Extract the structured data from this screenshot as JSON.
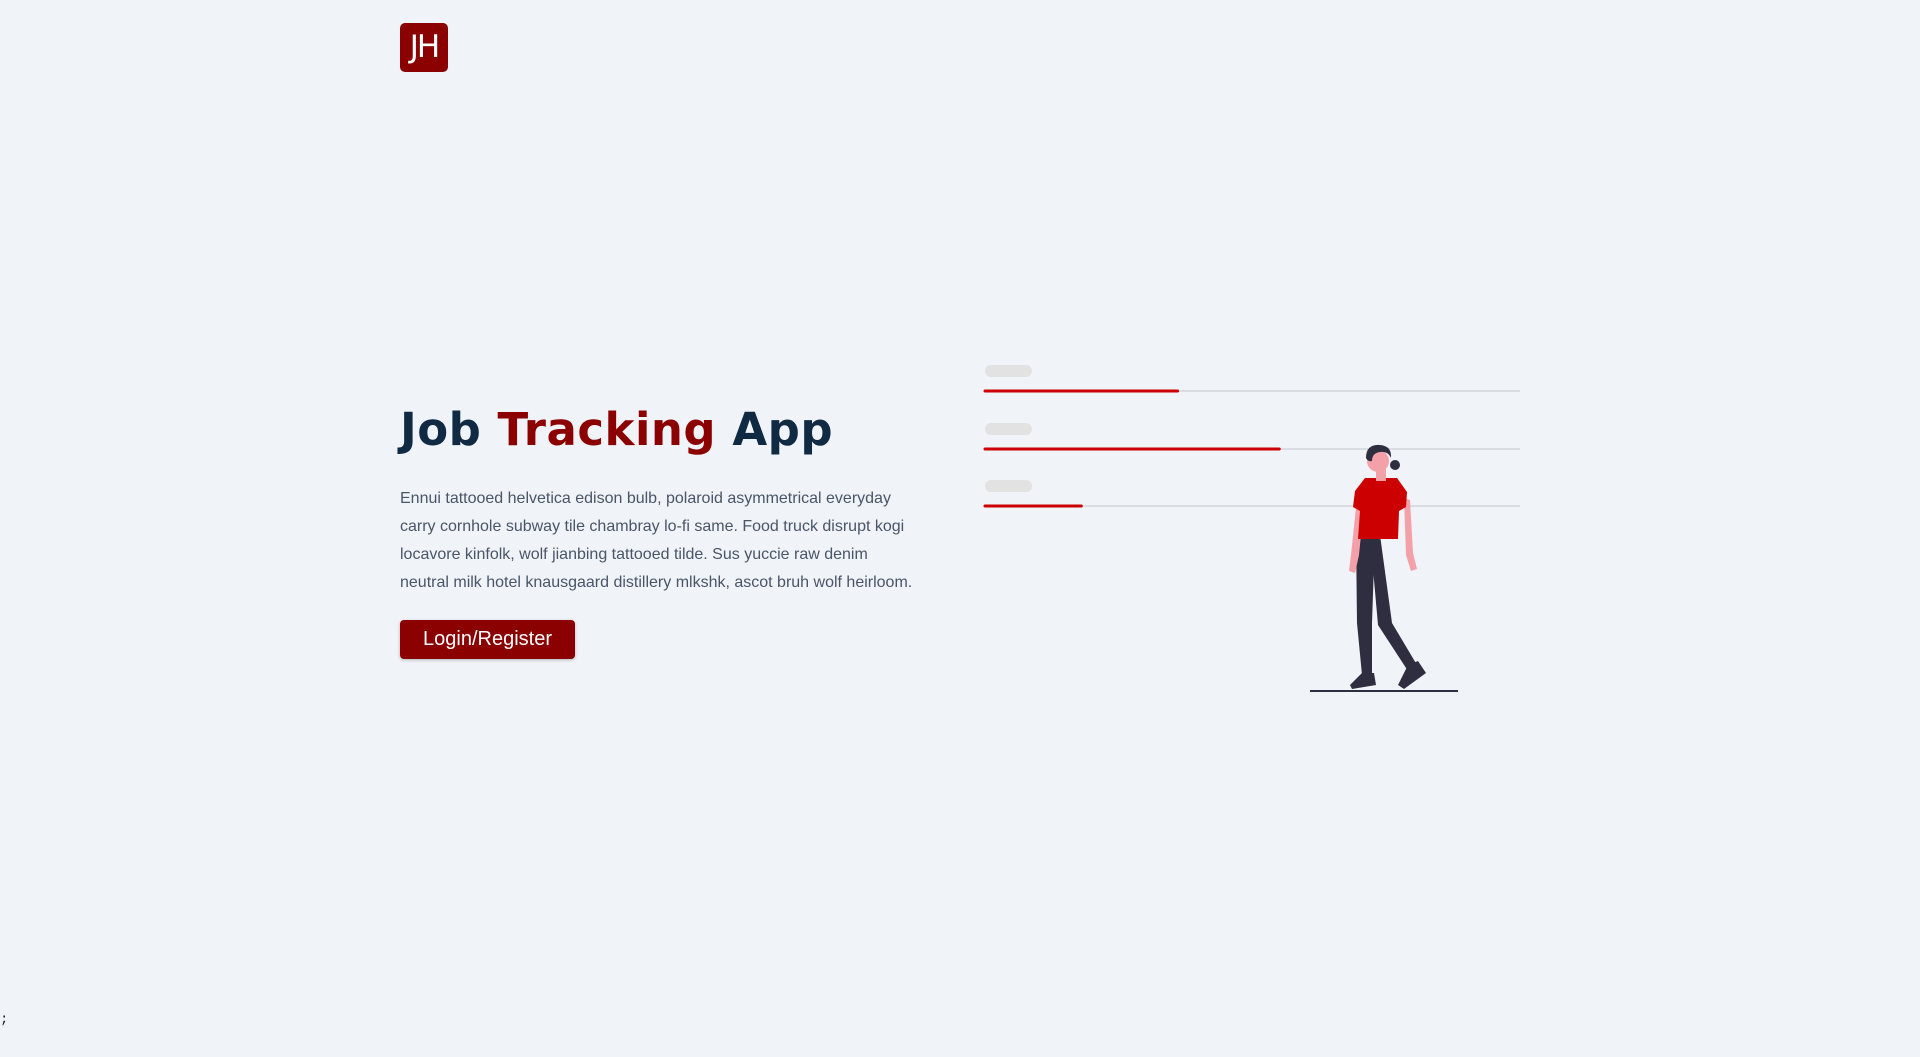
{
  "brand": {
    "logo_text": "JH"
  },
  "hero": {
    "title_part1": "Job",
    "title_accent": "Tracking",
    "title_part3": "App",
    "description": "Ennui tattooed helvetica edison bulb, polaroid asymmetrical everyday carry cornhole subway tile chambray lo-fi same. Food truck disrupt kogi locavore kinfolk, wolf jianbing tattooed tilde. Sus yuccie raw denim neutral milk hotel knausgaard distillery mlkshk, ascot bruh wolf heirloom.",
    "cta_label": "Login/Register"
  },
  "illustration": {
    "progress_bars": [
      0.36,
      0.55,
      0.18
    ],
    "accent_color": "#cc0000",
    "figure": "woman-walking"
  },
  "footer": {
    "stray_text": ";"
  },
  "colors": {
    "background": "#f0f3f7",
    "brand_primary": "#8b0000",
    "heading_dark": "#102a43",
    "body_text": "#4a5568"
  }
}
